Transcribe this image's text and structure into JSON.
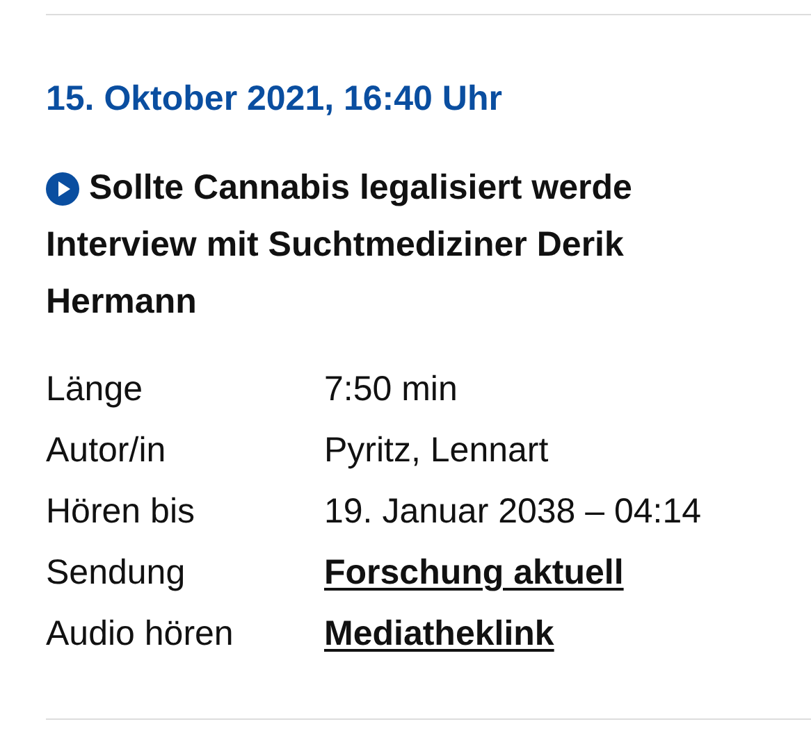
{
  "date": "15. Oktober 2021, 16:40 Uhr",
  "title_lines": [
    "Sollte Cannabis legalisiert werde",
    "Interview mit Suchtmediziner Derik",
    "Hermann"
  ],
  "details": [
    {
      "label": "Länge",
      "value": "7:50 min",
      "kind": "text"
    },
    {
      "label": "Autor/in",
      "value": "Pyritz, Lennart",
      "kind": "text"
    },
    {
      "label": "Hören bis",
      "value": "19. Januar 2038 – 04:14",
      "kind": "text"
    },
    {
      "label": "Sendung",
      "value": "Forschung aktuell",
      "kind": "link"
    },
    {
      "label": "Audio hören",
      "value": "Mediatheklink",
      "kind": "link"
    }
  ]
}
